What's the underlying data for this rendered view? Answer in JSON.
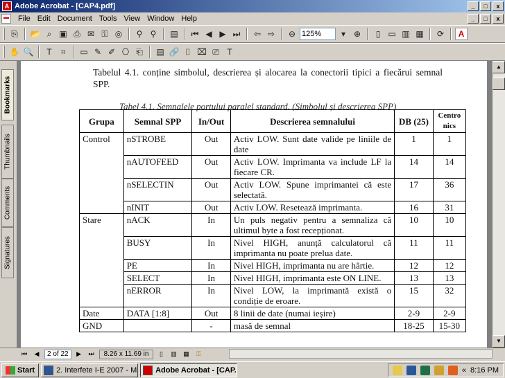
{
  "window": {
    "title": "Adobe Acrobat - [CAP4.pdf]",
    "min": "_",
    "max": "□",
    "close": "x",
    "mdi_min": "_",
    "mdi_max": "□",
    "mdi_close": "x"
  },
  "menu": [
    "File",
    "Edit",
    "Document",
    "Tools",
    "View",
    "Window",
    "Help"
  ],
  "toolbar": {
    "zoom_value": "125%"
  },
  "sidebar_tabs": [
    "Bookmarks",
    "Thumbnails",
    "Comments",
    "Signatures"
  ],
  "doc": {
    "intro": "Tabelul 4.1. conține simbolul, descrierea și alocarea la conectorii tipici a fiecărui semnal SPP.",
    "caption": "Tabel 4.1. Semnalele portului paralel standard. (Simbolul și descrierea SPP)",
    "headers": {
      "grupa": "Grupa",
      "semnal": "Semnal SPP",
      "inout": "In/Out",
      "descriere": "Descrierea semnalului",
      "db": "DB (25)",
      "centronics": "Centro nics"
    },
    "rows": [
      {
        "grupa": "Control",
        "semnal": "nSTROBE",
        "inout": "Out",
        "desc": "Activ LOW. Sunt date valide pe liniile de date",
        "db": "1",
        "cen": "1"
      },
      {
        "grupa": "",
        "semnal": "nAUTOFEED",
        "inout": "Out",
        "desc": "Activ LOW. Imprimanta va include LF la fiecare CR.",
        "db": "14",
        "cen": "14"
      },
      {
        "grupa": "",
        "semnal": "nSELECTIN",
        "inout": "Out",
        "desc": "Activ LOW. Spune imprimantei că este selectată.",
        "db": "17",
        "cen": "36"
      },
      {
        "grupa": "",
        "semnal": "nINIT",
        "inout": "Out",
        "desc": "Activ LOW. Resetează imprimanta.",
        "db": "16",
        "cen": "31"
      },
      {
        "grupa": "Stare",
        "semnal": "nACK",
        "inout": "In",
        "desc": "Un puls negativ pentru a semnaliza că ultimul byte a fost recepționat.",
        "db": "10",
        "cen": "10"
      },
      {
        "grupa": "",
        "semnal": "BUSY",
        "inout": "In",
        "desc": "Nivel HIGH, anunță calculatorul că imprimanta nu poate prelua date.",
        "db": "11",
        "cen": "11"
      },
      {
        "grupa": "",
        "semnal": "PE",
        "inout": "In",
        "desc": "Nivel HIGH, imprimanta nu are hârtie.",
        "db": "12",
        "cen": "12"
      },
      {
        "grupa": "",
        "semnal": "SELECT",
        "inout": "In",
        "desc": "Nivel HIGH, imprimanta este ON LINE.",
        "db": "13",
        "cen": "13"
      },
      {
        "grupa": "",
        "semnal": "nERROR",
        "inout": "In",
        "desc": "Nivel LOW, la imprimantă există o condiție de eroare.",
        "db": "15",
        "cen": "32"
      },
      {
        "grupa": "Date",
        "semnal": "DATA [1:8]",
        "inout": "Out",
        "desc": "8 linii de date (numai ieșire)",
        "db": "2-9",
        "cen": "2-9"
      },
      {
        "grupa": "GND",
        "semnal": "",
        "inout": "-",
        "desc": "masă de semnal",
        "db": "18-25",
        "cen": "15-30"
      }
    ]
  },
  "navbar": {
    "page": "2 of 22",
    "page_size": "8.26 x 11.69 in"
  },
  "taskbar": {
    "start": "Start",
    "tasks": [
      "2. Interfete I-E 2007 - M...",
      "Adobe Acrobat - [CAP..."
    ],
    "tray_arrow": "«",
    "clock": "8:16 PM"
  }
}
